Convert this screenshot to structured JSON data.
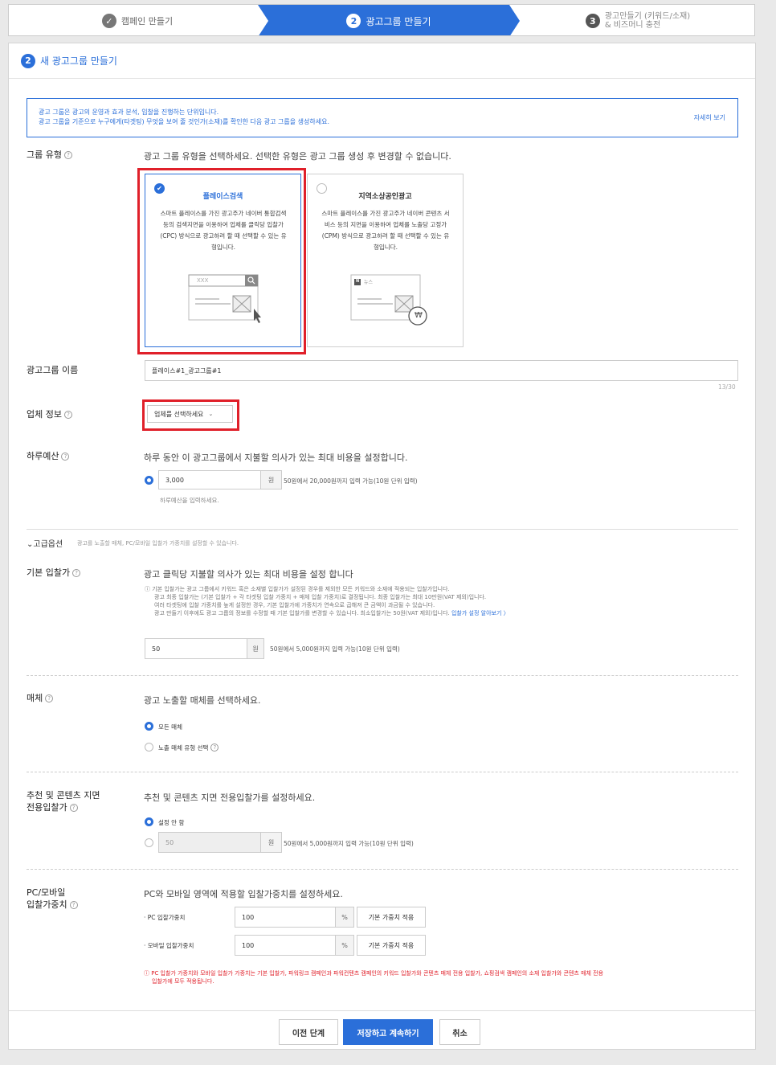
{
  "stepper": {
    "step1": {
      "num": "✓",
      "label": "캠페인 만들기"
    },
    "step2": {
      "num": "2",
      "label": "광고그룹 만들기"
    },
    "step3": {
      "num": "3",
      "label_line1": "광고만들기 (키워드/소재)",
      "label_line2": "& 비즈머니 충전"
    }
  },
  "panel": {
    "num": "2",
    "title": "새 광고그룹 만들기",
    "info_line1": "광고 그룹은 광고의 운영과 효과 분석, 입찰을 진행하는 단위입니다.",
    "info_line2": "광고 그룹을 기준으로 누구에게(타겟팅) 무엇을 보여 줄 것인가(소재)를 확인한 다음 광고 그룹을 생성하세요.",
    "info_more": "자세히 보기"
  },
  "group_type": {
    "label": "그룹 유형",
    "desc": "광고 그룹 유형을 선택하세요. 선택한 유형은 광고 그룹 생성 후 변경할 수 없습니다.",
    "cards": [
      {
        "title": "플레이스검색",
        "body": "스마트 플레이스를 가진 광고주가 네이버 통합검색 등의 검색지면을 이용하여 업체를 클릭당 입찰가(CPC) 방식으로 광고하려 할 때 선택할 수 있는 유형입니다.",
        "search_placeholder": "XXX"
      },
      {
        "title": "지역소상공인광고",
        "body": "스마트 플레이스를 가진 광고주가 네이버 콘텐츠 서비스 등의 지면을 이용하여 업체를 노출당 고정가(CPM) 방식으로 광고하려 할 때 선택할 수 있는 유형입니다.",
        "news_label": "뉴스",
        "won": "₩"
      }
    ]
  },
  "group_name": {
    "label": "광고그룹 이름",
    "value": "플레이스#1_광고그룹#1",
    "counter": "13/30"
  },
  "business_info": {
    "label": "업체 정보",
    "select": "업체를 선택하세요"
  },
  "daily_budget": {
    "label": "하루예산",
    "desc": "하루 동안 이 광고그룹에서 지불할 의사가 있는 최대 비용을 설정합니다.",
    "value": "3,000",
    "unit": "원",
    "hint": "50원에서 20,000원까지 입력 가능(10원 단위 입력)",
    "helper": "하루예산을 입력하세요."
  },
  "advanced": {
    "label": "고급옵션",
    "desc": "광고를 노출할 매체, PC/모바일 입찰가 가중치를 설정할 수 있습니다."
  },
  "base_bid": {
    "label": "기본 입찰가",
    "desc": "광고 클릭당 지불할 의사가 있는 최대 비용을 설정 합니다",
    "note1": "ⓘ 기본 입찰가는 광고 그룹에서 키워드 혹은 소재별 입찰가가 설정된 경우를 제외한 모든 키워드와 소재에 적용되는 입찰가입니다.",
    "note2": "광고 최종 입찰가는 (기본 입찰가 + 각 타겟팅 입찰 가중치 + 매체 입찰 가중치)로 결정됩니다. 최종 입찰가는 최대 10만원(VAT 제외)입니다.",
    "note3": "여러 타겟팅에 입찰 가중치를 높게 설정한 경우, 기본 입찰가에 가중치가 연속으로 곱해져 큰 금액이 과금될 수 있습니다.",
    "note4": "광고 만들기 이후에도 광고 그룹의 정보를 수정할 때 기본 입찰가를 변경할 수 있습니다. 최소입찰가는 50원(VAT 제외)입니다.",
    "note_link": "입찰가 설정 알아보기 〉",
    "value": "50",
    "unit": "원",
    "hint": "50원에서 5,000원까지 입력 가능(10원 단위 입력)"
  },
  "media": {
    "label": "매체",
    "desc": "광고 노출할 매체를 선택하세요.",
    "opt1": "모든 매체",
    "opt2": "노출 매체 유형 선택"
  },
  "content_bid": {
    "label_line1": "추천 및 콘텐츠 지면",
    "label_line2": "전용입찰가",
    "desc": "추천 및 콘텐츠 지면 전용입찰가를 설정하세요.",
    "opt1": "설정 안 함",
    "value": "50",
    "unit": "원",
    "hint": "50원에서 5,000원까지 입력 가능(10원 단위 입력)"
  },
  "device_bid": {
    "label_line1": "PC/모바일",
    "label_line2": "입찰가중치",
    "desc": "PC와 모바일 영역에 적용할 입찰가중치를 설정하세요.",
    "pc_label": "· PC 입찰가중치",
    "pc_value": "100",
    "mobile_label": "· 모바일 입찰가중치",
    "mobile_value": "100",
    "unit": "%",
    "default_btn": "기본 가중치 적용",
    "warning1": "ⓘ PC 입찰가 가중치와 모바일 입찰가 가중치는 기본 입찰가, 파워링크 캠페인과 파워컨텐츠 캠페인의 키워드 입찰가와 콘텐츠 매체 전용 입찰가, 쇼핑검색 캠페인의 소재 입찰가와 콘텐츠 매체 전용",
    "warning2": "입찰가에 모두 적용됩니다."
  },
  "footer": {
    "prev": "이전 단계",
    "save": "저장하고 계속하기",
    "cancel": "취소"
  },
  "colors": {
    "accent": "#2b6fd9",
    "highlight": "#e0202a"
  }
}
